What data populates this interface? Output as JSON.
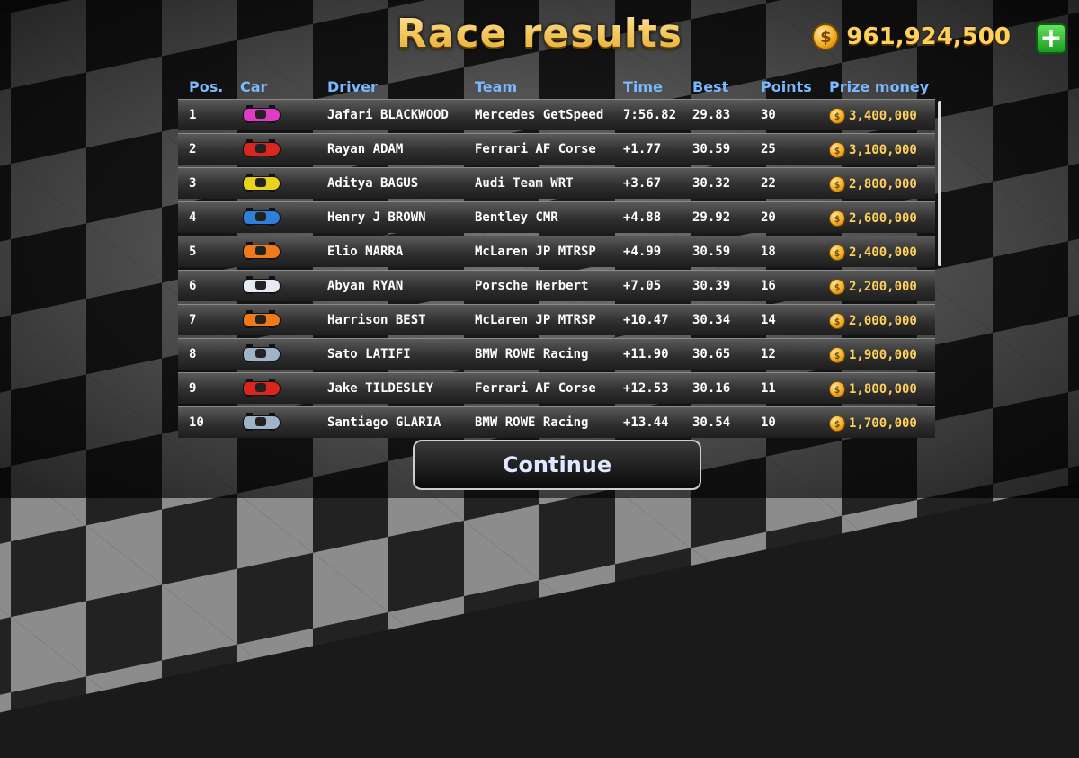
{
  "title": "Race results",
  "balance": "961,924,500",
  "add_button": "+",
  "columns": {
    "pos": "Pos.",
    "car": "Car",
    "driver": "Driver",
    "team": "Team",
    "time": "Time",
    "best": "Best",
    "points": "Points",
    "prize": "Prize money"
  },
  "rows": [
    {
      "pos": "1",
      "car_color": "#e03bc4",
      "driver": "Jafari BLACKWOOD",
      "team": "Mercedes GetSpeed",
      "time": "7:56.82",
      "best": "29.83",
      "points": "30",
      "prize": "3,400,000"
    },
    {
      "pos": "2",
      "car_color": "#d9261e",
      "driver": "Rayan ADAM",
      "team": "Ferrari AF Corse",
      "time": "+1.77",
      "best": "30.59",
      "points": "25",
      "prize": "3,100,000"
    },
    {
      "pos": "3",
      "car_color": "#e8d21d",
      "driver": "Aditya BAGUS",
      "team": "Audi Team WRT",
      "time": "+3.67",
      "best": "30.32",
      "points": "22",
      "prize": "2,800,000"
    },
    {
      "pos": "4",
      "car_color": "#2f7fd8",
      "driver": "Henry J BROWN",
      "team": "Bentley CMR",
      "time": "+4.88",
      "best": "29.92",
      "points": "20",
      "prize": "2,600,000"
    },
    {
      "pos": "5",
      "car_color": "#ee7a1a",
      "driver": "Elio MARRA",
      "team": "McLaren JP MTRSP",
      "time": "+4.99",
      "best": "30.59",
      "points": "18",
      "prize": "2,400,000"
    },
    {
      "pos": "6",
      "car_color": "#e6eaf2",
      "driver": "Abyan RYAN",
      "team": "Porsche Herbert",
      "time": "+7.05",
      "best": "30.39",
      "points": "16",
      "prize": "2,200,000"
    },
    {
      "pos": "7",
      "car_color": "#ee7a1a",
      "driver": "Harrison BEST",
      "team": "McLaren JP MTRSP",
      "time": "+10.47",
      "best": "30.34",
      "points": "14",
      "prize": "2,000,000"
    },
    {
      "pos": "8",
      "car_color": "#9fb4c8",
      "driver": "Sato LATIFI",
      "team": "BMW ROWE Racing",
      "time": "+11.90",
      "best": "30.65",
      "points": "12",
      "prize": "1,900,000"
    },
    {
      "pos": "9",
      "car_color": "#d9261e",
      "driver": "Jake TILDESLEY",
      "team": "Ferrari AF Corse",
      "time": "+12.53",
      "best": "30.16",
      "points": "11",
      "prize": "1,800,000"
    },
    {
      "pos": "10",
      "car_color": "#9fb4c8",
      "driver": "Santiago GLARIA",
      "team": "BMW ROWE Racing",
      "time": "+13.44",
      "best": "30.54",
      "points": "10",
      "prize": "1,700,000"
    }
  ],
  "continue_label": "Continue",
  "colors": {
    "header_text": "#7ab8ff",
    "gold": "#ffd15a",
    "add_green": "#2bb232"
  }
}
